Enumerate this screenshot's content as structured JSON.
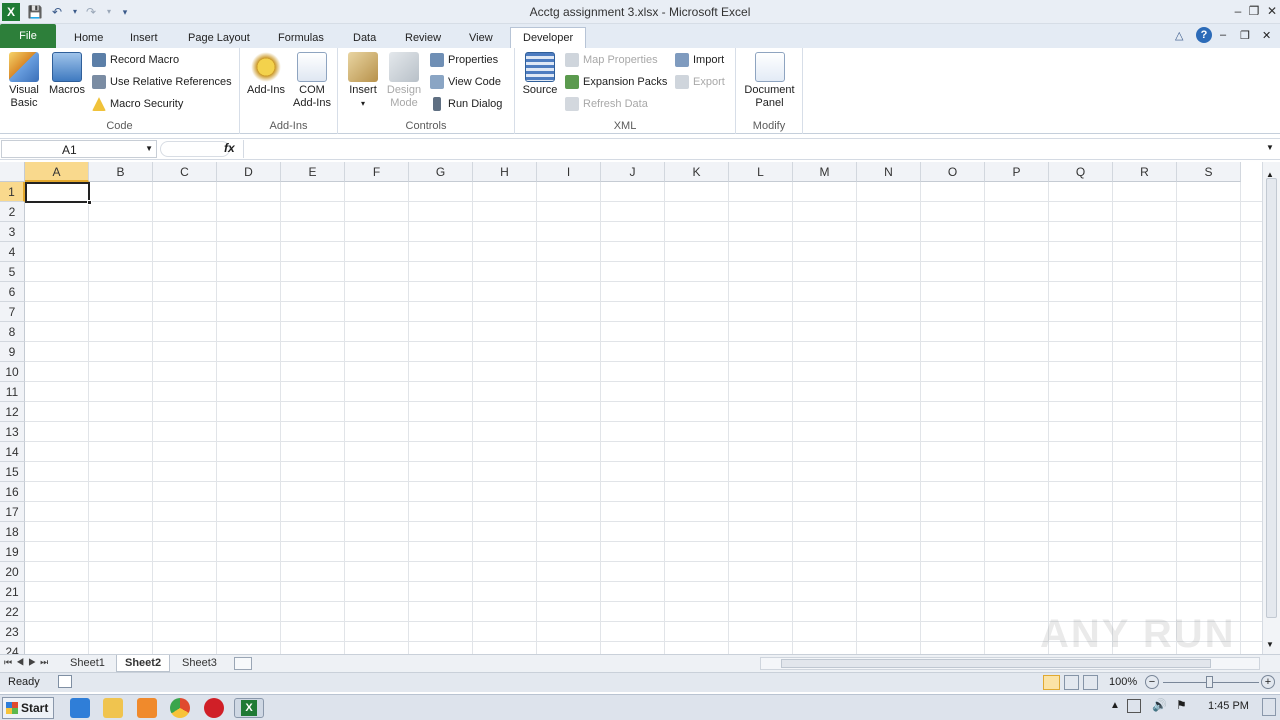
{
  "window": {
    "title": "Acctg assignment 3.xlsx -  Microsoft Excel"
  },
  "quick_access": {
    "icons": [
      "excel-logo-icon",
      "save-icon",
      "undo-icon",
      "redo-icon",
      "customize-icon"
    ]
  },
  "tabs": [
    {
      "label": "File"
    },
    {
      "label": "Home"
    },
    {
      "label": "Insert"
    },
    {
      "label": "Page Layout"
    },
    {
      "label": "Formulas"
    },
    {
      "label": "Data"
    },
    {
      "label": "Review"
    },
    {
      "label": "View"
    },
    {
      "label": "Developer"
    }
  ],
  "active_tab": "Developer",
  "ribbon": {
    "code": {
      "label": "Code",
      "visual_basic_line1": "Visual",
      "visual_basic_line2": "Basic",
      "macros": "Macros",
      "record_macro": "Record Macro",
      "use_relative": "Use Relative References",
      "macro_security": "Macro Security"
    },
    "addins": {
      "label": "Add-Ins",
      "addins": "Add-Ins",
      "com_line1": "COM",
      "com_line2": "Add-Ins"
    },
    "controls": {
      "label": "Controls",
      "insert": "Insert",
      "design_line1": "Design",
      "design_line2": "Mode",
      "properties": "Properties",
      "view_code": "View Code",
      "run_dialog": "Run Dialog"
    },
    "xml": {
      "label": "XML",
      "source": "Source",
      "map_properties": "Map Properties",
      "expansion_packs": "Expansion Packs",
      "refresh_data": "Refresh Data",
      "import": "Import",
      "export": "Export"
    },
    "modify": {
      "label": "Modify",
      "doc_line1": "Document",
      "doc_line2": "Panel"
    }
  },
  "formula_bar": {
    "name_box": "A1",
    "fx": "fx",
    "value": ""
  },
  "grid": {
    "columns": [
      "A",
      "B",
      "C",
      "D",
      "E",
      "F",
      "G",
      "H",
      "I",
      "J",
      "K",
      "L",
      "M",
      "N",
      "O",
      "P",
      "Q",
      "R",
      "S"
    ],
    "rows": [
      "1",
      "2",
      "3",
      "4",
      "5",
      "6",
      "7",
      "8",
      "9",
      "10",
      "11",
      "12",
      "13",
      "14",
      "15",
      "16",
      "17",
      "18",
      "19",
      "20",
      "21",
      "22",
      "23",
      "24"
    ],
    "selected_cell": "A1"
  },
  "sheets": [
    {
      "label": "Sheet1"
    },
    {
      "label": "Sheet2"
    },
    {
      "label": "Sheet3"
    }
  ],
  "active_sheet": "Sheet2",
  "status": {
    "ready": "Ready",
    "zoom": "100%"
  },
  "taskbar": {
    "start": "Start",
    "clock": "1:45 PM"
  },
  "watermark": "ANY RUN",
  "colors": {
    "file_tab": "#2d7f3a",
    "selection_header": "#f9d98d",
    "accent": "#e2a72c"
  }
}
